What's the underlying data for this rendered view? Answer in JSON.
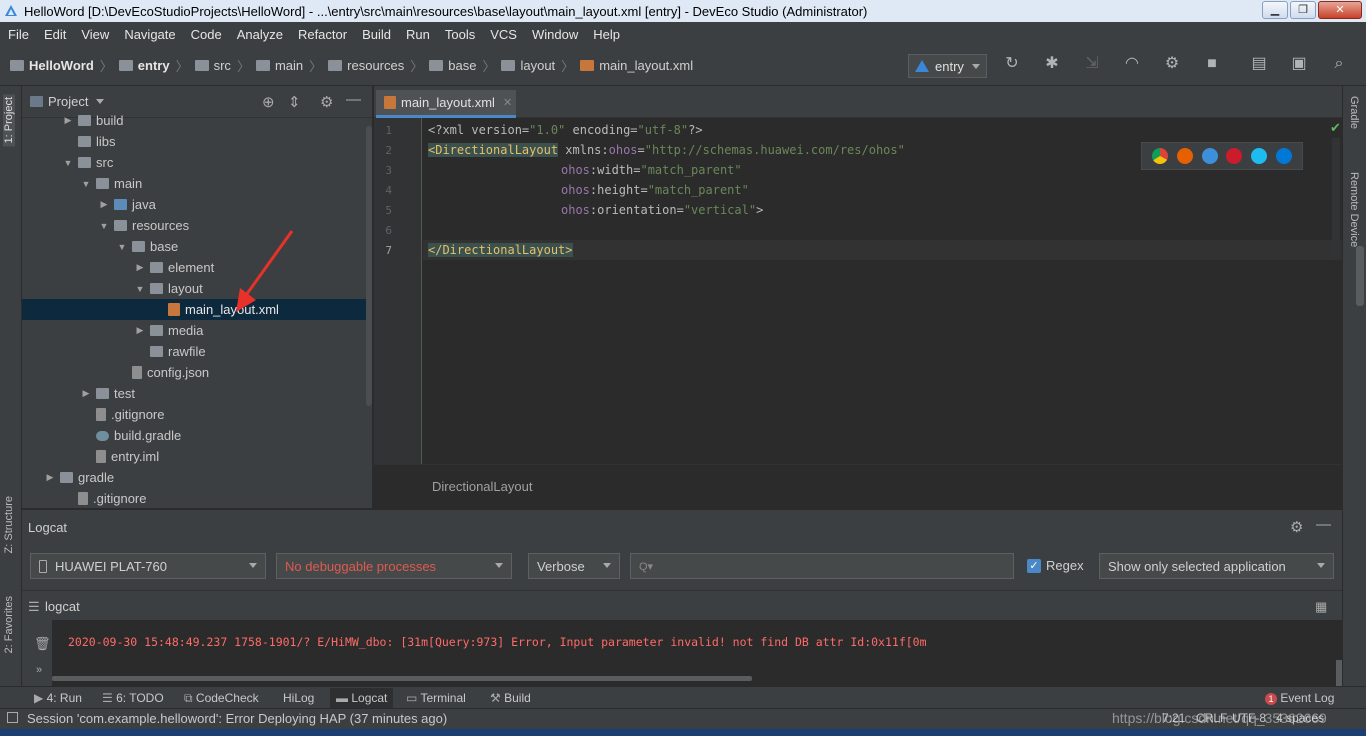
{
  "window": {
    "title": "HelloWord [D:\\DevEcoStudioProjects\\HelloWord] - ...\\entry\\src\\main\\resources\\base\\layout\\main_layout.xml [entry] - DevEco Studio (Administrator)",
    "minimize": "▁",
    "restore": "❐",
    "close": "✕"
  },
  "menu": [
    "File",
    "Edit",
    "View",
    "Navigate",
    "Code",
    "Analyze",
    "Refactor",
    "Build",
    "Run",
    "Tools",
    "VCS",
    "Window",
    "Help"
  ],
  "breadcrumbs": [
    "HelloWord",
    "entry",
    "src",
    "main",
    "resources",
    "base",
    "layout",
    "main_layout.xml"
  ],
  "run_config": "entry",
  "left_strip": {
    "project": "1: Project",
    "structure": "Z: Structure",
    "favorites": "2: Favorites"
  },
  "right_strip": {
    "gradle": "Gradle",
    "remote": "Remote Device"
  },
  "project_panel": {
    "title": "Project",
    "tree": [
      {
        "label": "build",
        "level": 2,
        "arrow": "▶",
        "icon": "folder"
      },
      {
        "label": "libs",
        "level": 2,
        "arrow": "",
        "icon": "folder"
      },
      {
        "label": "src",
        "level": 2,
        "arrow": "▼",
        "icon": "folder"
      },
      {
        "label": "main",
        "level": 3,
        "arrow": "▼",
        "icon": "folder"
      },
      {
        "label": "java",
        "level": 4,
        "arrow": "▶",
        "icon": "folder-blue"
      },
      {
        "label": "resources",
        "level": 4,
        "arrow": "▼",
        "icon": "folder"
      },
      {
        "label": "base",
        "level": 5,
        "arrow": "▼",
        "icon": "folder"
      },
      {
        "label": "element",
        "level": 6,
        "arrow": "▶",
        "icon": "folder"
      },
      {
        "label": "layout",
        "level": 6,
        "arrow": "▼",
        "icon": "folder"
      },
      {
        "label": "main_layout.xml",
        "level": 7,
        "arrow": "",
        "icon": "xml",
        "selected": true
      },
      {
        "label": "media",
        "level": 6,
        "arrow": "▶",
        "icon": "folder"
      },
      {
        "label": "rawfile",
        "level": 6,
        "arrow": "",
        "icon": "folder"
      },
      {
        "label": "config.json",
        "level": 5,
        "arrow": "",
        "icon": "file"
      },
      {
        "label": "test",
        "level": 3,
        "arrow": "▶",
        "icon": "folder"
      },
      {
        "label": ".gitignore",
        "level": 3,
        "arrow": "",
        "icon": "file"
      },
      {
        "label": "build.gradle",
        "level": 3,
        "arrow": "",
        "icon": "gradle"
      },
      {
        "label": "entry.iml",
        "level": 3,
        "arrow": "",
        "icon": "file"
      },
      {
        "label": "gradle",
        "level": 1,
        "arrow": "▶",
        "icon": "folder"
      },
      {
        "label": ".gitignore",
        "level": 2,
        "arrow": "",
        "icon": "file"
      }
    ]
  },
  "editor": {
    "tab": "main_layout.xml",
    "line_numbers": [
      "1",
      "2",
      "3",
      "4",
      "5",
      "6",
      "7"
    ],
    "code": {
      "l1_a": "<?xml version=",
      "l1_b": "\"1.0\"",
      "l1_c": " encoding=",
      "l1_d": "\"utf-8\"",
      "l1_e": "?>",
      "l2_tag": "<DirectionalLayout",
      "l2_attr": " xmlns:",
      "l2_ns": "ohos",
      "l2_eq": "=",
      "l2_val": "\"http://schemas.huawei.com/res/ohos\"",
      "l3_ns": "ohos",
      "l3_attr": ":width=",
      "l3_val": "\"match_parent\"",
      "l4_ns": "ohos",
      "l4_attr": ":height=",
      "l4_val": "\"match_parent\"",
      "l5_ns": "ohos",
      "l5_attr": ":orientation=",
      "l5_val": "\"vertical\"",
      "l5_end": ">",
      "l7_tag": "</DirectionalLayout>"
    },
    "breadcrumb": "DirectionalLayout"
  },
  "logcat": {
    "title": "Logcat",
    "device": "HUAWEI PLAT-760",
    "process": "No debuggable processes",
    "level": "Verbose",
    "search_placeholder": "Q▾",
    "regex_label": "Regex",
    "filter": "Show only selected application",
    "tab": "logcat",
    "log_line": "2020-09-30 15:48:49.237 1758-1901/? E/HiMW_dbo: \u001b[31m[Query:973] Error, Input parameter invalid! not find DB attr Id:0x11f\u001b[0m"
  },
  "tool_windows": {
    "run": "4: Run",
    "todo": "6: TODO",
    "codecheck": "CodeCheck",
    "hilog": "HiLog",
    "logcat": "Logcat",
    "terminal": "Terminal",
    "build": "Build",
    "event_log": "Event Log",
    "event_count": "1"
  },
  "status": {
    "message": "Session 'com.example.helloword': Error Deploying HAP (37 minutes ago)",
    "position": "7:21",
    "crlf": "CRLF",
    "encoding": "UTF-8",
    "spaces": "4 spaces",
    "watermark": "https://blog.csdn.net/qq_35362669"
  },
  "colors": {
    "accent": "#4a88c7",
    "error_text": "#ff6b68",
    "tag": "#e8bf6a",
    "string": "#6a8759",
    "namespace": "#9876aa"
  }
}
